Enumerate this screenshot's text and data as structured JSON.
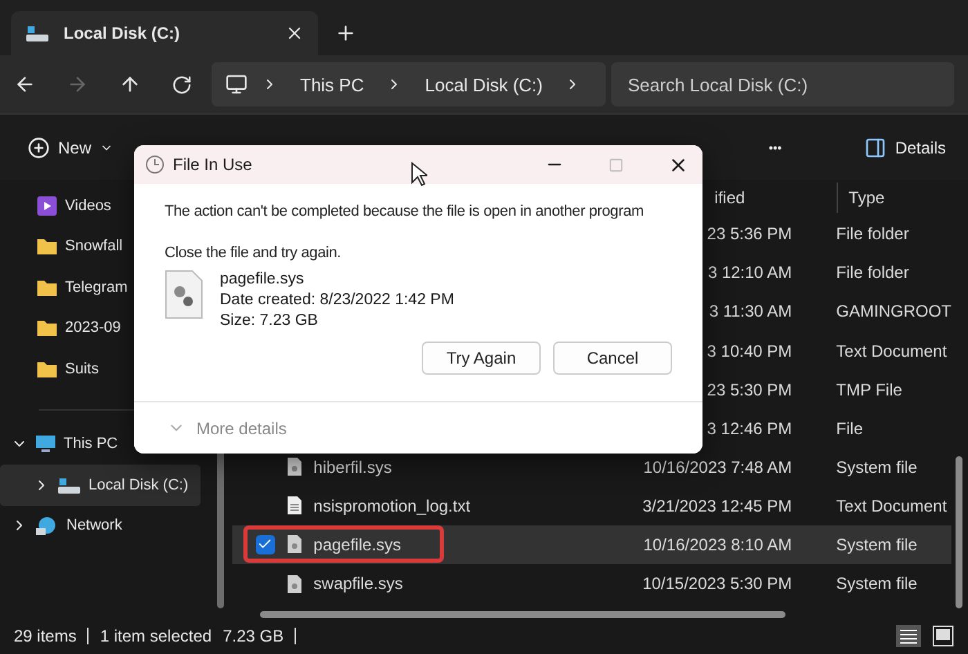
{
  "tab": {
    "title": "Local Disk (C:)"
  },
  "address": {
    "crumbs": [
      "This PC",
      "Local Disk (C:)"
    ],
    "search": {
      "placeholder": "Search Local Disk (C:)"
    }
  },
  "command_bar": {
    "new": "New",
    "more": "•••",
    "details": "Details"
  },
  "sidebar": {
    "quick_access": [
      {
        "label": "Videos",
        "kind": "video"
      },
      {
        "label": "Snowfall",
        "kind": "folder"
      },
      {
        "label": "Telegram",
        "kind": "folder"
      },
      {
        "label": "2023-09",
        "kind": "folder"
      },
      {
        "label": "Suits",
        "kind": "folder"
      }
    ],
    "tree": [
      {
        "label": "This PC",
        "kind": "pc",
        "expanded": true,
        "selected": false,
        "children": [
          {
            "label": "Local Disk (C:)",
            "kind": "drive",
            "expanded": false,
            "selected": true
          }
        ]
      },
      {
        "label": "Network",
        "kind": "network",
        "expanded": false,
        "selected": false
      }
    ]
  },
  "file_list": {
    "columns": [
      "ified",
      "Type"
    ],
    "rows": [
      {
        "modified": "23 5:36 PM",
        "type": "File folder"
      },
      {
        "modified": "3 12:10 AM",
        "type": "File folder"
      },
      {
        "modified": "3 11:30 AM",
        "type": "GAMINGROOT"
      },
      {
        "modified": "3 10:40 PM",
        "type": "Text Document"
      },
      {
        "modified": "23 5:30 PM",
        "type": "TMP File"
      },
      {
        "modified": "3 12:46 PM",
        "type": "File"
      },
      {
        "name": "hiberfil.sys",
        "kind": "system",
        "modified": "10/16/2023 7:48 AM",
        "type": "System file",
        "selected": false,
        "checked": false,
        "highlighted": false
      },
      {
        "name": "nsispromotion_log.txt",
        "kind": "text",
        "modified": "3/21/2023 12:45 PM",
        "type": "Text Document",
        "selected": false,
        "checked": false,
        "highlighted": false
      },
      {
        "name": "pagefile.sys",
        "kind": "system",
        "modified": "10/16/2023 8:10 AM",
        "type": "System file",
        "selected": true,
        "checked": true,
        "highlighted": true
      },
      {
        "name": "swapfile.sys",
        "kind": "system",
        "modified": "10/15/2023 5:30 PM",
        "type": "System file",
        "selected": false,
        "checked": false,
        "highlighted": false
      }
    ]
  },
  "status_bar": {
    "items": [
      "29 items",
      "1 item selected",
      "7.23 GB"
    ]
  },
  "dialog": {
    "title": "File In Use",
    "message": "The action can't be completed because the file is open in another program",
    "instruction": "Close the file and try again.",
    "file": {
      "name": "pagefile.sys",
      "date": "Date created: 8/23/2022 1:42 PM",
      "size": "Size: 7.23 GB"
    },
    "buttons": [
      "Try Again",
      "Cancel"
    ],
    "more_details": "More details"
  }
}
